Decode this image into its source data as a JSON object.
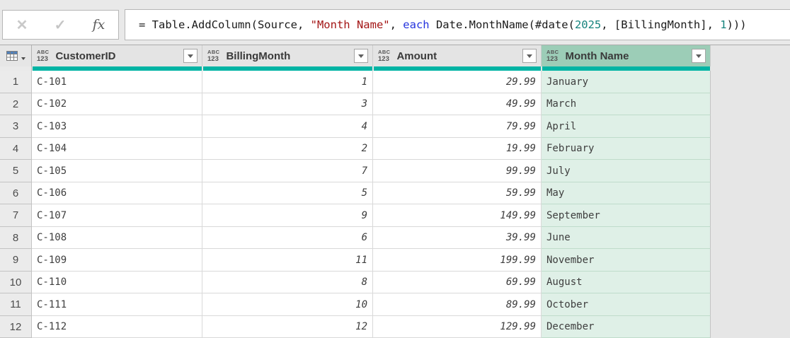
{
  "formula_bar": {
    "cancel_glyph": "✕",
    "commit_glyph": "✓",
    "fx_glyph": "fx",
    "formula_text": "= Table.AddColumn(Source, \"Month Name\", each Date.MonthName(#date(2025, [BillingMonth], 1)))",
    "segments": [
      {
        "text": "= Table.AddColumn(Source, ",
        "token": "plain"
      },
      {
        "text": "\"Month Name\"",
        "token": "string"
      },
      {
        "text": ", ",
        "token": "plain"
      },
      {
        "text": "each",
        "token": "keyword"
      },
      {
        "text": " Date.MonthName(#date(",
        "token": "plain"
      },
      {
        "text": "2025",
        "token": "number"
      },
      {
        "text": ", [BillingMonth], ",
        "token": "plain"
      },
      {
        "text": "1",
        "token": "number"
      },
      {
        "text": ")))",
        "token": "plain"
      }
    ]
  },
  "colors": {
    "token_plain": "#1a1a1a",
    "token_string": "#a31515",
    "token_keyword": "#2433dd",
    "token_number": "#16837d",
    "accent_teal": "#00b4a4",
    "selected_header_bg": "#9ccdb7",
    "selected_cell_bg": "#dff0e7",
    "selected_cell_border": "#bfdccb",
    "header_bg": "#e4e4e4"
  },
  "grid": {
    "type_badge_top": "ABC",
    "type_badge_bottom": "123",
    "columns": [
      {
        "label": "CustomerID",
        "selected": false,
        "align": "left",
        "italic": false
      },
      {
        "label": "BillingMonth",
        "selected": false,
        "align": "right",
        "italic": true
      },
      {
        "label": "Amount",
        "selected": false,
        "align": "right",
        "italic": true
      },
      {
        "label": "Month Name",
        "selected": true,
        "align": "left",
        "italic": false
      }
    ],
    "rows": [
      {
        "row_number": "1",
        "cells": [
          "C-101",
          "1",
          "29.99",
          "January"
        ]
      },
      {
        "row_number": "2",
        "cells": [
          "C-102",
          "3",
          "49.99",
          "March"
        ]
      },
      {
        "row_number": "3",
        "cells": [
          "C-103",
          "4",
          "79.99",
          "April"
        ]
      },
      {
        "row_number": "4",
        "cells": [
          "C-104",
          "2",
          "19.99",
          "February"
        ]
      },
      {
        "row_number": "5",
        "cells": [
          "C-105",
          "7",
          "99.99",
          "July"
        ]
      },
      {
        "row_number": "6",
        "cells": [
          "C-106",
          "5",
          "59.99",
          "May"
        ]
      },
      {
        "row_number": "7",
        "cells": [
          "C-107",
          "9",
          "149.99",
          "September"
        ]
      },
      {
        "row_number": "8",
        "cells": [
          "C-108",
          "6",
          "39.99",
          "June"
        ]
      },
      {
        "row_number": "9",
        "cells": [
          "C-109",
          "11",
          "199.99",
          "November"
        ]
      },
      {
        "row_number": "10",
        "cells": [
          "C-110",
          "8",
          "69.99",
          "August"
        ]
      },
      {
        "row_number": "11",
        "cells": [
          "C-111",
          "10",
          "89.99",
          "October"
        ]
      },
      {
        "row_number": "12",
        "cells": [
          "C-112",
          "12",
          "129.99",
          "December"
        ]
      }
    ]
  }
}
